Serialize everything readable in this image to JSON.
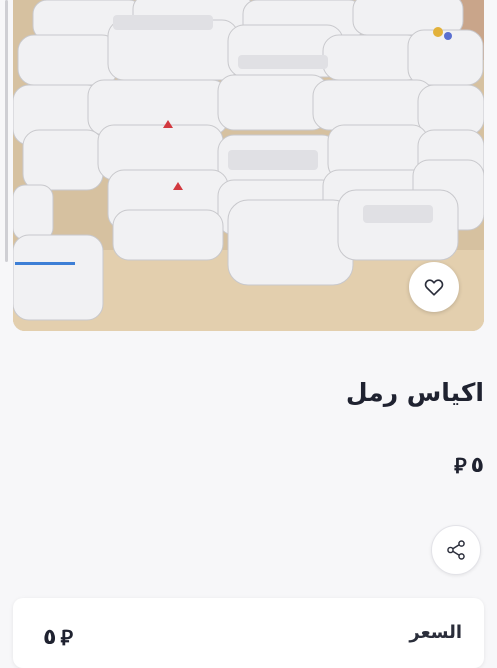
{
  "product": {
    "title": "اكياس رمل",
    "price": "٥",
    "currency_symbol": "⃁",
    "image_subject": "stacked white sand bags"
  },
  "actions": {
    "favorite_icon": "heart-icon",
    "share_icon": "share-icon"
  },
  "details_card": {
    "label": "السعر",
    "value": "٥",
    "currency_symbol": "⃁"
  },
  "colors": {
    "text": "#1f2230",
    "background": "#f7f7f9",
    "card": "#ffffff"
  }
}
